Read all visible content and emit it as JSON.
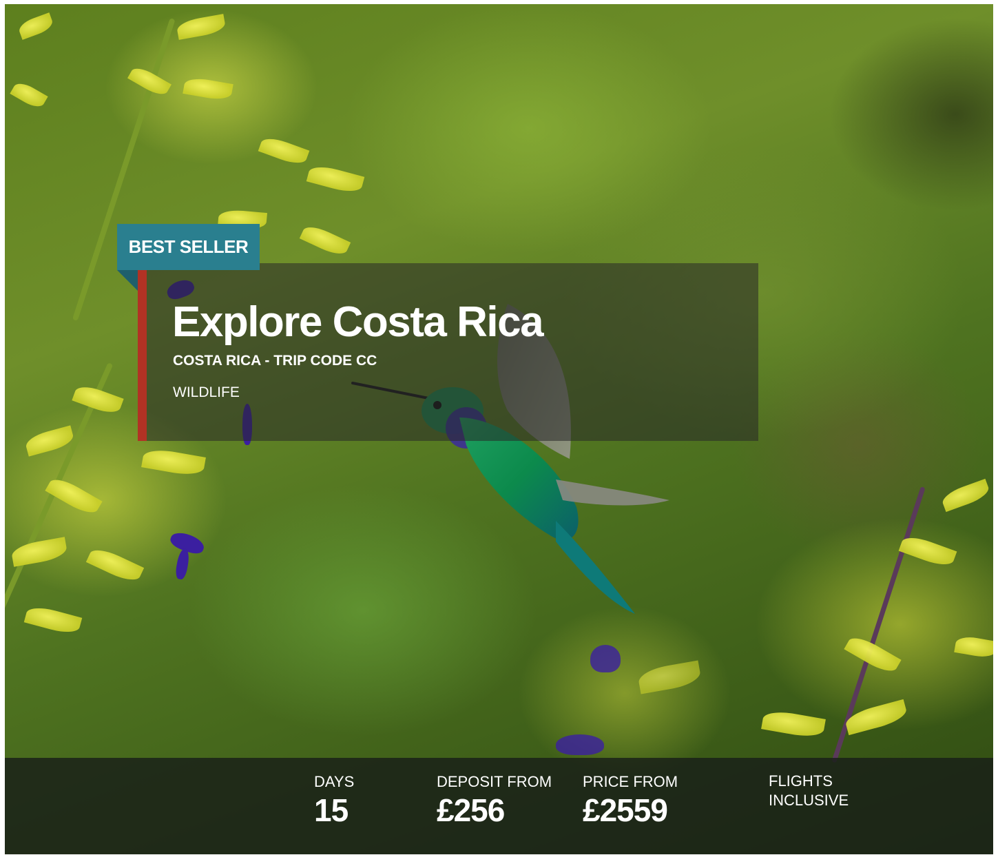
{
  "tour": {
    "badge": "BEST SELLER",
    "title": "Explore Costa Rica",
    "subtitle": "COSTA RICA - TRIP CODE CC",
    "category": "WILDLIFE"
  },
  "stats": {
    "days_label": "DAYS",
    "days_value": "15",
    "deposit_label": "DEPOSIT FROM",
    "deposit_value": "£256",
    "price_label": "PRICE FROM",
    "price_value": "£2559",
    "flights_label": "FLIGHTS INCLUSIVE"
  },
  "colors": {
    "badge": "#2a7f8f",
    "accent": "#b13224"
  }
}
